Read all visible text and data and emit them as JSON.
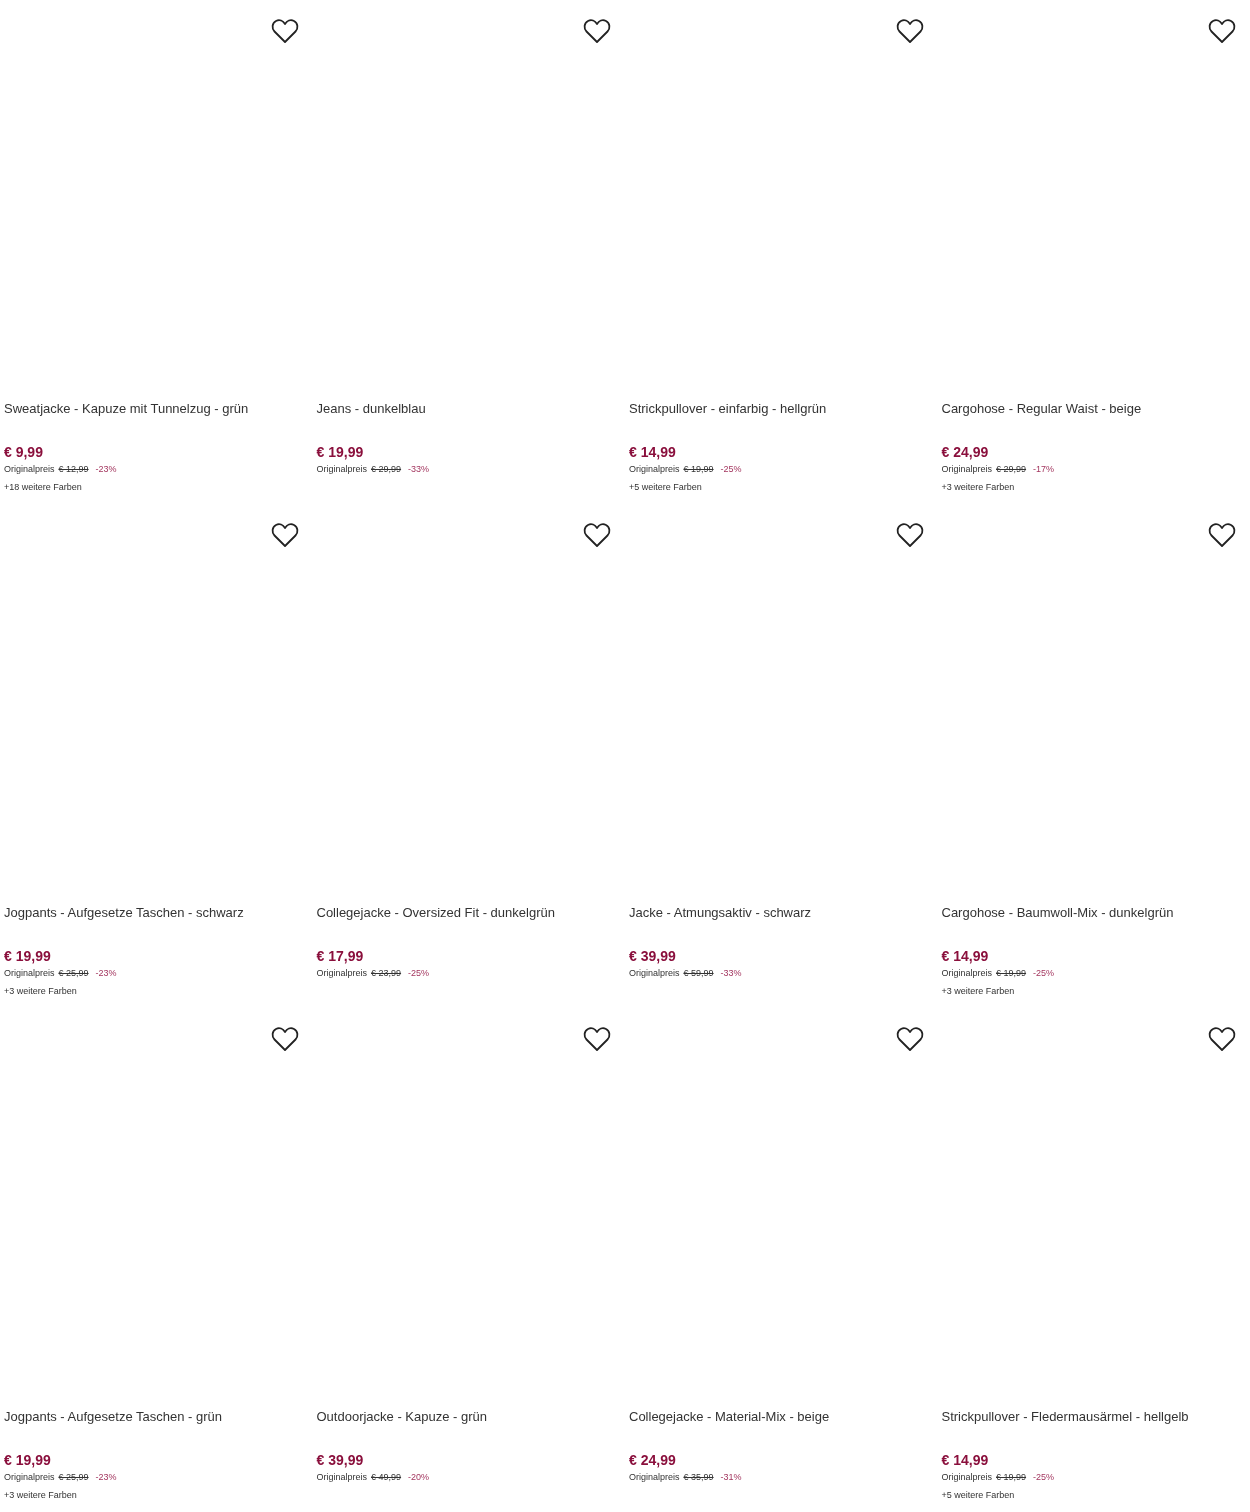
{
  "products": [
    {
      "title": "Sweatjacke - Kapuze mit Tunnelzug - grün",
      "price": "€ 9,99",
      "original_label": "Originalpreis",
      "original_price": "€ 12,99",
      "discount": "-23%",
      "more_colors": "+18 weitere Farben"
    },
    {
      "title": "Jeans - dunkelblau",
      "price": "€ 19,99",
      "original_label": "Originalpreis",
      "original_price": "€ 29,99",
      "discount": "-33%"
    },
    {
      "title": "Strickpullover - einfarbig - hellgrün",
      "price": "€ 14,99",
      "original_label": "Originalpreis",
      "original_price": "€ 19,99",
      "discount": "-25%",
      "more_colors": "+5 weitere Farben"
    },
    {
      "title": "Cargohose - Regular Waist - beige",
      "price": "€ 24,99",
      "original_label": "Originalpreis",
      "original_price": "€ 29,99",
      "discount": "-17%",
      "more_colors": "+3 weitere Farben"
    },
    {
      "title": "Jogpants - Aufgesetze Taschen - schwarz",
      "price": "€ 19,99",
      "original_label": "Originalpreis",
      "original_price": "€ 25,99",
      "discount": "-23%",
      "more_colors": "+3 weitere Farben"
    },
    {
      "title": "Collegejacke - Oversized Fit - dunkelgrün",
      "price": "€ 17,99",
      "original_label": "Originalpreis",
      "original_price": "€ 23,99",
      "discount": "-25%"
    },
    {
      "title": "Jacke - Atmungsaktiv - schwarz",
      "price": "€ 39,99",
      "original_label": "Originalpreis",
      "original_price": "€ 59,99",
      "discount": "-33%"
    },
    {
      "title": "Cargohose - Baumwoll-Mix - dunkelgrün",
      "price": "€ 14,99",
      "original_label": "Originalpreis",
      "original_price": "€ 19,99",
      "discount": "-25%",
      "more_colors": "+3 weitere Farben"
    },
    {
      "title": "Jogpants - Aufgesetze Taschen - grün",
      "price": "€ 19,99",
      "original_label": "Originalpreis",
      "original_price": "€ 25,99",
      "discount": "-23%",
      "more_colors": "+3 weitere Farben"
    },
    {
      "title": "Outdoorjacke - Kapuze - grün",
      "price": "€ 39,99",
      "original_label": "Originalpreis",
      "original_price": "€ 49,99",
      "discount": "-20%"
    },
    {
      "title": "Collegejacke - Material-Mix - beige",
      "price": "€ 24,99",
      "original_label": "Originalpreis",
      "original_price": "€ 35,99",
      "discount": "-31%"
    },
    {
      "title": "Strickpullover - Fledermausärmel - hellgelb",
      "price": "€ 14,99",
      "original_label": "Originalpreis",
      "original_price": "€ 19,99",
      "discount": "-25%",
      "more_colors": "+5 weitere Farben"
    }
  ]
}
